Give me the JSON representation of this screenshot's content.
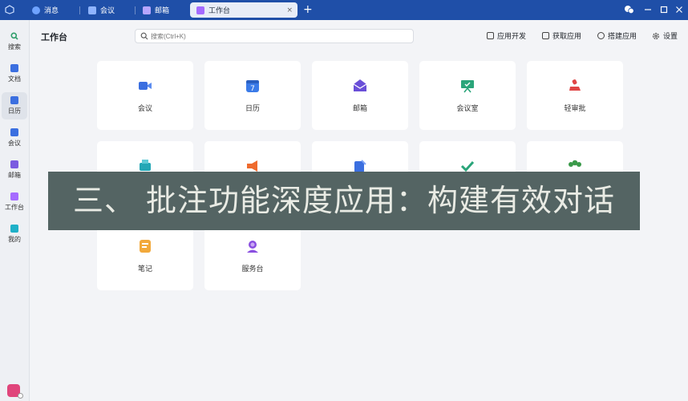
{
  "tabs": [
    {
      "label": "消息",
      "icon": "chat-icon",
      "color": "#6fa3ff"
    },
    {
      "label": "会议",
      "icon": "video-icon",
      "color": "#8fb4ff"
    },
    {
      "label": "邮箱",
      "icon": "mail-icon",
      "color": "#b7a6ff"
    },
    {
      "label": "工作台",
      "icon": "workbench-icon",
      "color": "#a56bff",
      "active": true
    }
  ],
  "tab_close": "×",
  "new_tab": "+",
  "sidebar": {
    "items": [
      {
        "label": "搜索",
        "icon": "search-icon",
        "color": "#2f9e6b"
      },
      {
        "label": "文档",
        "icon": "document-icon",
        "color": "#3b6fe0"
      },
      {
        "label": "日历",
        "icon": "calendar-icon",
        "color": "#3b6fe0",
        "active": true
      },
      {
        "label": "会议",
        "icon": "video-icon",
        "color": "#3b6fe0"
      },
      {
        "label": "邮箱",
        "icon": "mail-icon",
        "color": "#7b5ce0"
      },
      {
        "label": "工作台",
        "icon": "workbench-icon",
        "color": "#a56bff"
      },
      {
        "label": "我的",
        "icon": "cube-icon",
        "color": "#1fb0c8"
      }
    ]
  },
  "header": {
    "title": "工作台",
    "search_placeholder": "搜索(Ctrl+K)",
    "actions": [
      {
        "label": "应用开发",
        "icon": "dev-icon"
      },
      {
        "label": "获取应用",
        "icon": "apps-icon"
      },
      {
        "label": "搭建应用",
        "icon": "build-icon"
      },
      {
        "label": "设置",
        "icon": "gear-icon"
      }
    ]
  },
  "apps": [
    {
      "label": "会议",
      "icon": "video-icon",
      "color": "#3b6fe0"
    },
    {
      "label": "日历",
      "icon": "calendar-icon",
      "color": "#3b7be8"
    },
    {
      "label": "邮箱",
      "icon": "mail-icon",
      "color": "#6a4fd8"
    },
    {
      "label": "会议室",
      "icon": "meeting-room-icon",
      "color": "#2aa57a"
    },
    {
      "label": "轻审批",
      "icon": "stamp-icon",
      "color": "#e04545"
    },
    {
      "label": "",
      "icon": "printer-icon",
      "color": "#23a7b5"
    },
    {
      "label": "",
      "icon": "megaphone-icon",
      "color": "#ef6a2d"
    },
    {
      "label": "",
      "icon": "form-icon",
      "color": "#3b6fe0"
    },
    {
      "label": "",
      "icon": "check-icon",
      "color": "#2aa57a"
    },
    {
      "label": "",
      "icon": "group-icon",
      "color": "#3a9a4a"
    },
    {
      "label": "笔记",
      "icon": "notebook-icon",
      "color": "#f2a93b"
    },
    {
      "label": "服务台",
      "icon": "service-desk-icon",
      "color": "#8a4fe0"
    }
  ],
  "overlay": {
    "text": "三、 批注功能深度应用：构建有效对话"
  }
}
